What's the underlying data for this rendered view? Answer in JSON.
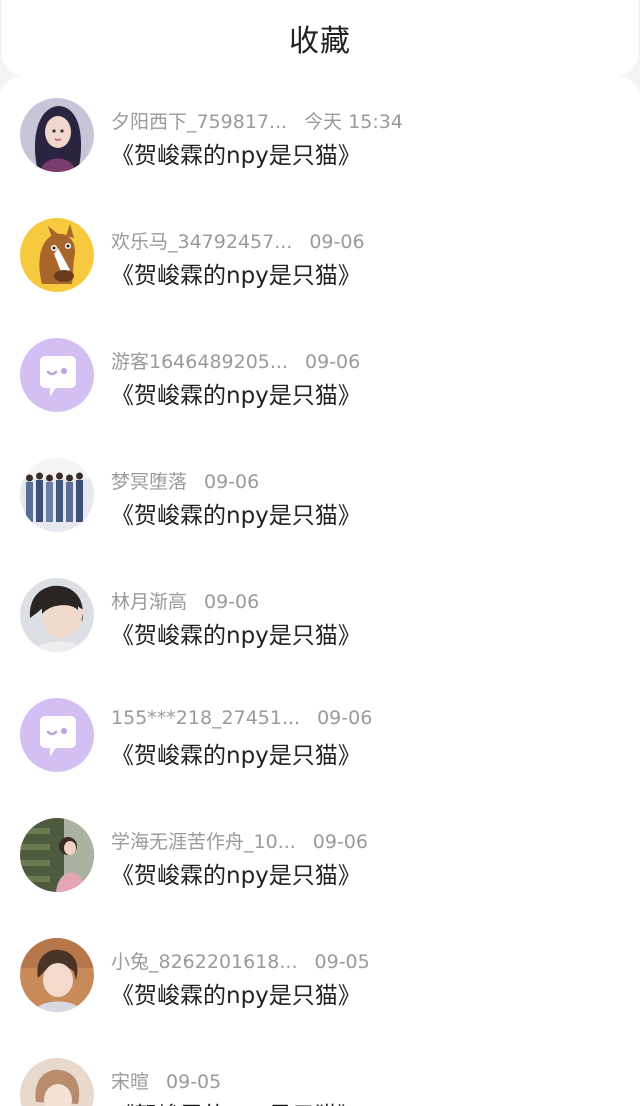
{
  "header": {
    "title": "收藏"
  },
  "colors": {
    "accent_purple": "#d3bff2",
    "text_primary": "#222222",
    "text_secondary": "#9a9a9a"
  },
  "items": [
    {
      "name": "夕阳西下_759817...",
      "time": "今天 15:34",
      "text": "《贺峻霖的npy是只猫》",
      "avatar": "illustrated-woman"
    },
    {
      "name": "欢乐马_34792457...",
      "time": "09-06",
      "text": "《贺峻霖的npy是只猫》",
      "avatar": "cartoon-horse"
    },
    {
      "name": "游客1646489205...",
      "time": "09-06",
      "text": "《贺峻霖的npy是只猫》",
      "avatar": "default-chat"
    },
    {
      "name": "梦冥堕落",
      "time": "09-06",
      "text": "《贺峻霖的npy是只猫》",
      "avatar": "group-photo"
    },
    {
      "name": "林月渐高",
      "time": "09-06",
      "text": "《贺峻霖的npy是只猫》",
      "avatar": "person-photo"
    },
    {
      "name": "155***218_27451...",
      "time": "09-06",
      "text": "《贺峻霖的npy是只猫》",
      "avatar": "default-chat"
    },
    {
      "name": "学海无涯苦作舟_10...",
      "time": "09-06",
      "text": "《贺峻霖的npy是只猫》",
      "avatar": "library-photo"
    },
    {
      "name": "小兔_8262201618...",
      "time": "09-05",
      "text": "《贺峻霖的npy是只猫》",
      "avatar": "person-photo"
    },
    {
      "name": "宋暄",
      "time": "09-05",
      "text": "《贺峻霖的npy是只猫》",
      "avatar": "person-photo"
    }
  ]
}
